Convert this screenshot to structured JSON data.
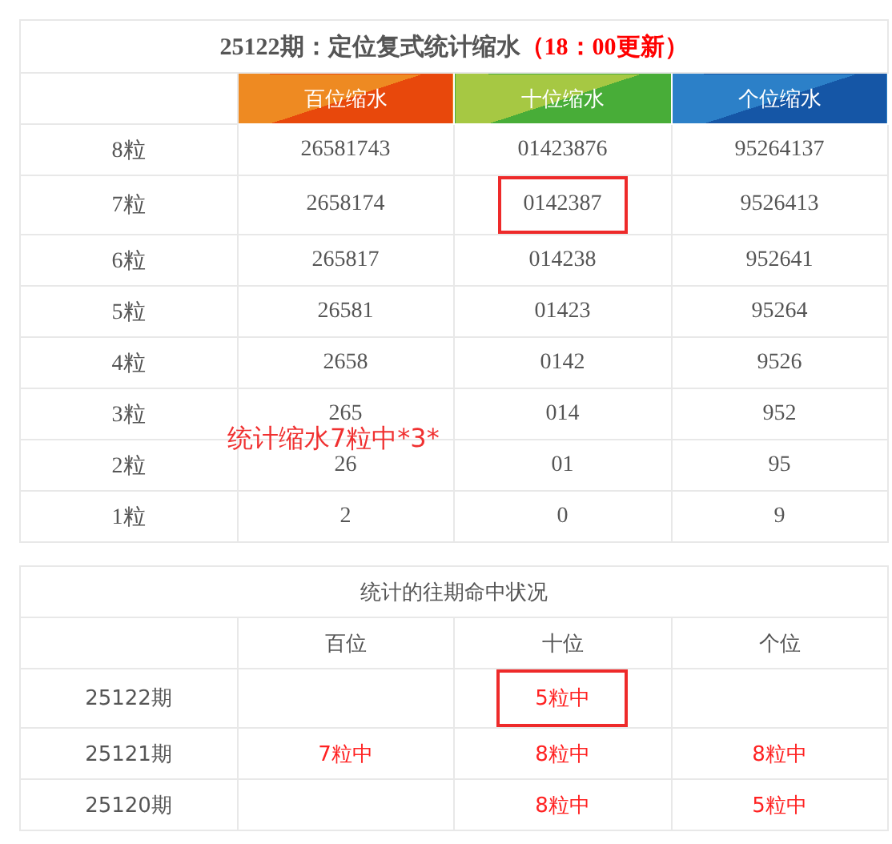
{
  "title": {
    "text": "25122期：定位复式统计缩水",
    "note": "（18：00更新）"
  },
  "columns": [
    {
      "label": "百位缩水",
      "kind": "hundreds"
    },
    {
      "label": "十位缩水",
      "kind": "tens"
    },
    {
      "label": "个位缩水",
      "kind": "units"
    }
  ],
  "rows": [
    {
      "label": "8粒",
      "cells": [
        {
          "text": "26581743",
          "highlighted": false
        },
        {
          "text": "01423876",
          "highlighted": false
        },
        {
          "text": "95264137",
          "highlighted": false
        }
      ]
    },
    {
      "label": "7粒",
      "cells": [
        {
          "text": "2658174",
          "highlighted": false
        },
        {
          "text": "0142387",
          "highlighted": true
        },
        {
          "text": "9526413",
          "highlighted": false
        }
      ]
    },
    {
      "label": "6粒",
      "cells": [
        {
          "text": "265817",
          "highlighted": false
        },
        {
          "text": "014238",
          "highlighted": false
        },
        {
          "text": "952641",
          "highlighted": false
        }
      ]
    },
    {
      "label": "5粒",
      "cells": [
        {
          "text": "26581",
          "highlighted": false
        },
        {
          "text": "01423",
          "highlighted": false
        },
        {
          "text": "95264",
          "highlighted": false
        }
      ]
    },
    {
      "label": "4粒",
      "cells": [
        {
          "text": "2658",
          "highlighted": false
        },
        {
          "text": "0142",
          "highlighted": false
        },
        {
          "text": "9526",
          "highlighted": false
        }
      ]
    },
    {
      "label": "3粒",
      "cells": [
        {
          "text": "265",
          "highlighted": false
        },
        {
          "text": "014",
          "highlighted": false
        },
        {
          "text": "952",
          "highlighted": false
        }
      ]
    },
    {
      "label": "2粒",
      "cells": [
        {
          "text": "26",
          "highlighted": false
        },
        {
          "text": "01",
          "highlighted": false
        },
        {
          "text": "95",
          "highlighted": false
        }
      ]
    },
    {
      "label": "1粒",
      "cells": [
        {
          "text": "2",
          "highlighted": false
        },
        {
          "text": "0",
          "highlighted": false
        },
        {
          "text": "9",
          "highlighted": false
        }
      ]
    }
  ],
  "annotation": "统计缩水7粒中*3*",
  "history": {
    "title": "统计的往期命中状况",
    "columns": [
      "百位",
      "十位",
      "个位"
    ],
    "rows": [
      {
        "period": "25122期",
        "cells": [
          null,
          {
            "text": "5粒中",
            "highlighted": true
          },
          null
        ]
      },
      {
        "period": "25121期",
        "cells": [
          {
            "text": "7粒中",
            "highlighted": false
          },
          {
            "text": "8粒中",
            "highlighted": false
          },
          {
            "text": "8粒中",
            "highlighted": false
          }
        ]
      },
      {
        "period": "25120期",
        "cells": [
          null,
          {
            "text": "8粒中",
            "highlighted": false
          },
          {
            "text": "5粒中",
            "highlighted": false
          }
        ]
      }
    ]
  }
}
